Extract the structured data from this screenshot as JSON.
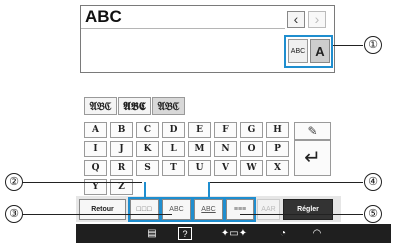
{
  "text_field": {
    "value": "ABC"
  },
  "nav": {
    "left_arrow": "‹",
    "right_arrow": "›"
  },
  "case_toggle": {
    "lowercase_label": "ABC",
    "uppercase_label": "A"
  },
  "font_tabs": [
    "𝔄𝔅ℭ",
    "𝕬𝕭𝕮",
    "𝔄𝔅ℭ"
  ],
  "keyboard": {
    "rows": [
      [
        "A",
        "B",
        "C",
        "D",
        "E",
        "F",
        "G",
        "H"
      ],
      [
        "I",
        "J",
        "K",
        "L",
        "M",
        "N",
        "O",
        "P"
      ],
      [
        "Q",
        "R",
        "S",
        "T",
        "U",
        "V",
        "W",
        "X"
      ],
      [
        "Y",
        "Z"
      ]
    ],
    "eraser_icon": "✎",
    "enter_icon": "↵"
  },
  "toolbar": {
    "retour_label": "Retour",
    "font_size_label": "□□□",
    "array_label": "ABC",
    "spacing_label": "ABC",
    "align_label": "≡≡≡",
    "disabled_label": "AAR",
    "regler_label": "Régler"
  },
  "statusbar": {
    "icons": [
      "page-icon",
      "help-icon",
      "presser-foot-icon",
      "clock-icon",
      "wifi-icon"
    ],
    "help_label": "?"
  },
  "callouts": [
    "①",
    "②",
    "③",
    "④",
    "⑤"
  ],
  "colors": {
    "highlight": "#1f8ecf",
    "status_bg": "#1f1f1f",
    "regler_bg": "#333333"
  }
}
